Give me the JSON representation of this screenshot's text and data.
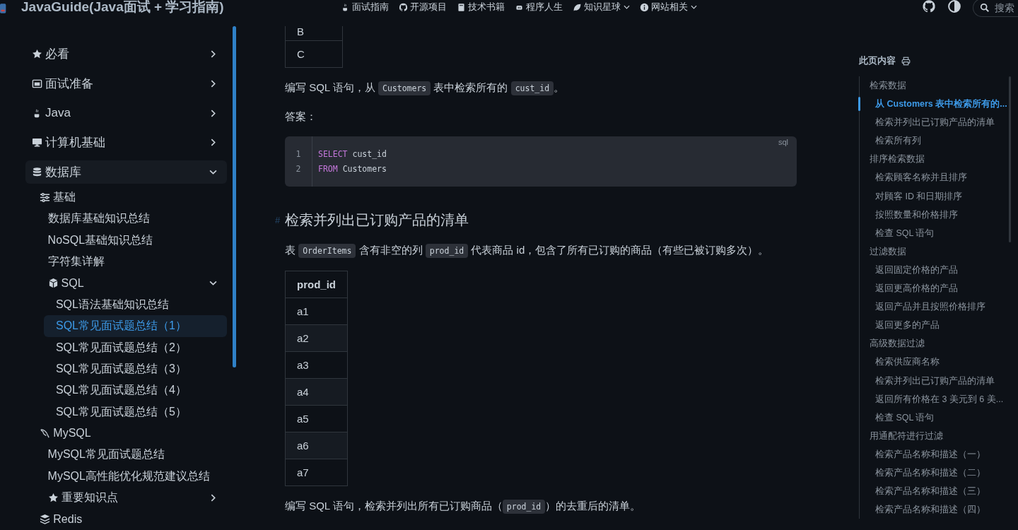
{
  "header": {
    "title": "JavaGuide(Java面试 + 学习指南)",
    "nav": [
      {
        "label": "面试指南",
        "dropdown": false
      },
      {
        "label": "开源项目",
        "dropdown": false
      },
      {
        "label": "技术书籍",
        "dropdown": false
      },
      {
        "label": "程序人生",
        "dropdown": false
      },
      {
        "label": "知识星球",
        "dropdown": true
      },
      {
        "label": "网站相关",
        "dropdown": true
      }
    ],
    "search": {
      "placeholder": "搜索"
    }
  },
  "sidebar": {
    "items": [
      {
        "label": "必看",
        "expanded": false,
        "selected": false
      },
      {
        "label": "面试准备",
        "expanded": false,
        "selected": false
      },
      {
        "label": "Java",
        "expanded": false,
        "selected": false
      },
      {
        "label": "计算机基础",
        "expanded": false,
        "selected": false
      },
      {
        "label": "数据库",
        "expanded": true,
        "selected": false,
        "children": [
          {
            "label": "基础",
            "selected": false,
            "children": [
              {
                "label": "数据库基础知识总结",
                "selected": false
              },
              {
                "label": "NoSQL基础知识总结",
                "selected": false
              },
              {
                "label": "字符集详解",
                "selected": false
              },
              {
                "label": "SQL",
                "expanded": true,
                "selected": false,
                "children": [
                  {
                    "label": "SQL语法基础知识总结",
                    "selected": false
                  },
                  {
                    "label": "SQL常见面试题总结（1）",
                    "selected": true
                  },
                  {
                    "label": "SQL常见面试题总结（2）",
                    "selected": false
                  },
                  {
                    "label": "SQL常见面试题总结（3）",
                    "selected": false
                  },
                  {
                    "label": "SQL常见面试题总结（4）",
                    "selected": false
                  },
                  {
                    "label": "SQL常见面试题总结（5）",
                    "selected": false
                  }
                ]
              }
            ]
          },
          {
            "label": "MySQL",
            "selected": false,
            "children": [
              {
                "label": "MySQL常见面试题总结",
                "selected": false
              },
              {
                "label": "MySQL高性能优化规范建议总结",
                "selected": false
              },
              {
                "label": "重要知识点",
                "expanded": false,
                "selected": false
              }
            ]
          },
          {
            "label": "Redis",
            "selected": false
          }
        ]
      }
    ]
  },
  "content": {
    "blocks": [
      {
        "kind": "table",
        "rows": [
          "B",
          "C"
        ]
      },
      {
        "kind": "paragraph",
        "parts": [
          {
            "kind": "text",
            "text": "编写 SQL 语句，从 "
          },
          {
            "kind": "code",
            "text": "Customers"
          },
          {
            "kind": "text",
            "text": " 表中检索所有的 "
          },
          {
            "kind": "code",
            "text": "cust_id"
          },
          {
            "kind": "text",
            "text": "。"
          }
        ]
      },
      {
        "kind": "paragraph",
        "parts": [
          {
            "kind": "text",
            "text": "答案："
          }
        ]
      },
      {
        "kind": "code_block",
        "language": "sql",
        "lines": [
          {
            "number": "1",
            "keyword": "SELECT",
            "text": " cust_id"
          },
          {
            "number": "2",
            "keyword": "FROM",
            "text": " Customers"
          }
        ]
      },
      {
        "kind": "heading",
        "anchor": "#",
        "text": "检索并列出已订购产品的清单"
      },
      {
        "kind": "paragraph",
        "parts": [
          {
            "kind": "text",
            "text": "表 "
          },
          {
            "kind": "code",
            "text": "OrderItems"
          },
          {
            "kind": "text",
            "text": " 含有非空的列 "
          },
          {
            "kind": "code",
            "text": "prod_id"
          },
          {
            "kind": "text",
            "text": " 代表商品 id，包含了所有已订购的商品（有些已被订购多次）。"
          }
        ]
      },
      {
        "kind": "table",
        "columns": [
          "prod_id"
        ],
        "rows": [
          "a1",
          "a2",
          "a3",
          "a4",
          "a5",
          "a6",
          "a7"
        ]
      },
      {
        "kind": "paragraph",
        "parts": [
          {
            "kind": "text",
            "text": "编写 SQL 语句，检索并列出所有已订购商品（"
          },
          {
            "kind": "code",
            "text": "prod_id"
          },
          {
            "kind": "text",
            "text": "）的去重后的清单。"
          }
        ]
      }
    ]
  },
  "toc": {
    "title": "此页内容",
    "items": [
      {
        "label": "检索数据",
        "selected": false,
        "children": [
          {
            "label": "从 Customers 表中检索所有的...",
            "selected": true
          },
          {
            "label": "检索并列出已订购产品的清单",
            "selected": false
          },
          {
            "label": "检索所有列",
            "selected": false
          }
        ]
      },
      {
        "label": "排序检索数据",
        "selected": false,
        "children": [
          {
            "label": "检索顾客名称并且排序",
            "selected": false
          },
          {
            "label": "对顾客 ID 和日期排序",
            "selected": false
          },
          {
            "label": "按照数量和价格排序",
            "selected": false
          },
          {
            "label": "检查 SQL 语句",
            "selected": false
          }
        ]
      },
      {
        "label": "过滤数据",
        "selected": false,
        "children": [
          {
            "label": "返回固定价格的产品",
            "selected": false
          },
          {
            "label": "返回更高价格的产品",
            "selected": false
          },
          {
            "label": "返回产品并且按照价格排序",
            "selected": false
          },
          {
            "label": "返回更多的产品",
            "selected": false
          }
        ]
      },
      {
        "label": "高级数据过滤",
        "selected": false,
        "children": [
          {
            "label": "检索供应商名称",
            "selected": false
          },
          {
            "label": "检索并列出已订购产品的清单",
            "selected": false
          },
          {
            "label": "返回所有价格在 3 美元到 6 美...",
            "selected": false
          },
          {
            "label": "检查 SQL 语句",
            "selected": false
          }
        ]
      },
      {
        "label": "用通配符进行过滤",
        "selected": false,
        "children": [
          {
            "label": "检索产品名称和描述（一）",
            "selected": false
          },
          {
            "label": "检索产品名称和描述（二）",
            "selected": false
          },
          {
            "label": "检索产品名称和描述（三）",
            "selected": false
          },
          {
            "label": "检索产品名称和描述（四）",
            "selected": false
          }
        ]
      }
    ]
  }
}
